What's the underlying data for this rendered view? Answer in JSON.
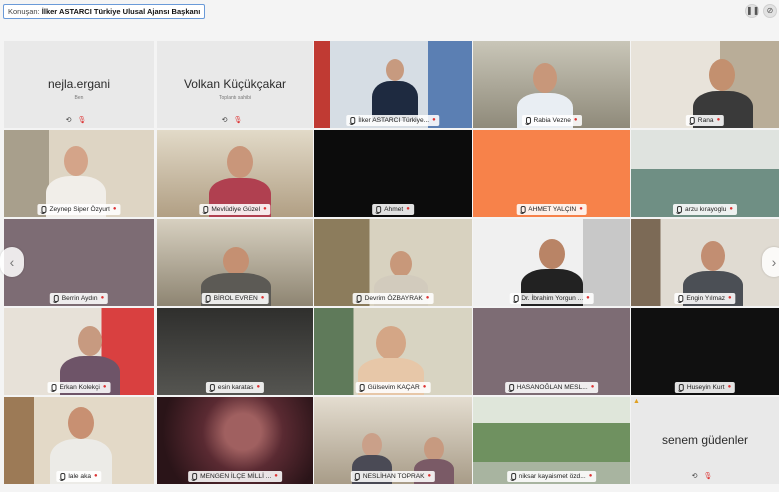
{
  "topbar": {
    "speaker_label": "Konuşan:",
    "speaker_name": "İlker ASTARCI Türkiye Ulusal Ajansı Başkanı",
    "icons": [
      "pause-icon",
      "link-icon"
    ]
  },
  "self_tile": {
    "name": "nejla.ergani",
    "sub": "Ben"
  },
  "host_tile": {
    "name": "Volkan Küçükçakar",
    "sub": "Toplantı sahibi"
  },
  "participants": [
    "İlker ASTARCI Türkiye...",
    "Rabia Vezne",
    "Rana",
    "Zeynep Siper Özyurt",
    "Mevlüdiye Güzel",
    "Ahmet",
    "AHMET YALÇIN",
    "arzu kırayoglu",
    "Berrin Aydın",
    "BİROL EVREN",
    "Devrim ÖZBAYRAK",
    "Dr. İbrahim Yorgun ...",
    "Engin Yılmaz",
    "Erkan Kolekçi",
    "esin karatas",
    "Gülsevim KAÇAR",
    "HASANOĞLAN MESL...",
    "Huseyin Kurt",
    "lale aka",
    "MENGEN İLÇE MİLLİ ...",
    "NESLİHAN TOPRAK",
    "niksar kayaismet özd...",
    "senem güdenler"
  ],
  "nav": {
    "left": "‹",
    "right": "›"
  },
  "colors": {
    "spotlight": "#1e7fd6",
    "speaker_border": "#6a9ad8",
    "orange_tile": "#f7824a"
  }
}
